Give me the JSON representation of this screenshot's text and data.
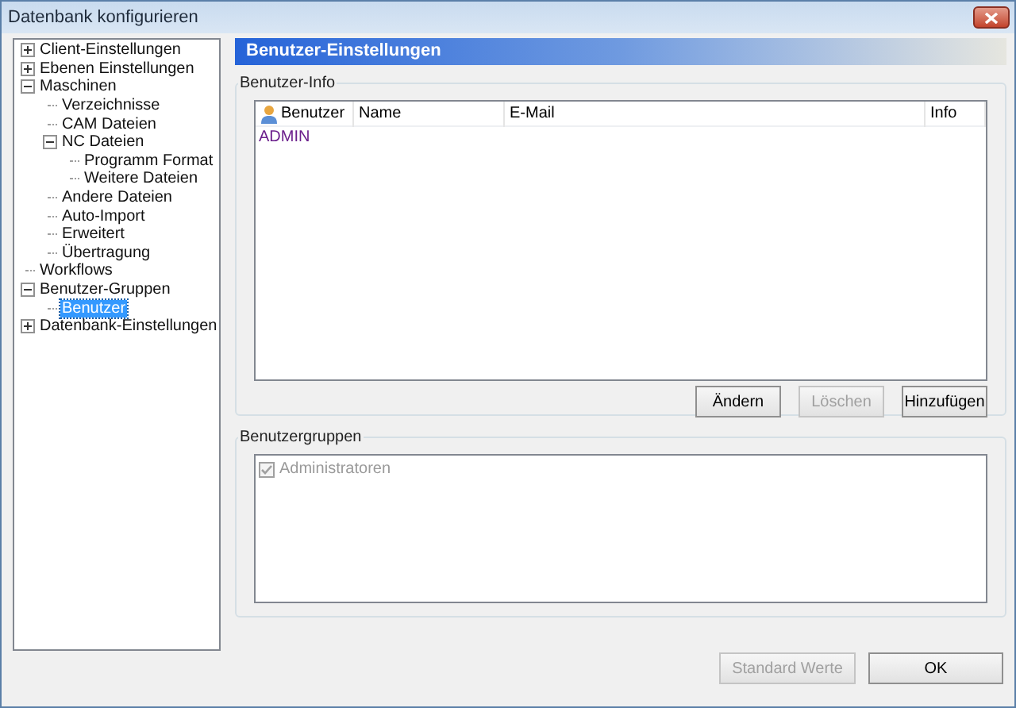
{
  "window": {
    "title": "Datenbank konfigurieren"
  },
  "tree": [
    {
      "label": "Client-Einstellungen",
      "expanded": false,
      "selected": false
    },
    {
      "label": "Ebenen Einstellungen",
      "expanded": false,
      "selected": false
    },
    {
      "label": "Maschinen",
      "expanded": true,
      "selected": false,
      "children": [
        {
          "label": "Verzeichnisse",
          "selected": false
        },
        {
          "label": "CAM Dateien",
          "selected": false
        },
        {
          "label": "NC Dateien",
          "expanded": true,
          "selected": false,
          "children": [
            {
              "label": "Programm Format",
              "selected": false
            },
            {
              "label": "Weitere Dateien",
              "selected": false
            }
          ]
        },
        {
          "label": "Andere Dateien",
          "selected": false
        },
        {
          "label": "Auto-Import",
          "selected": false
        },
        {
          "label": "Erweitert",
          "selected": false
        },
        {
          "label": "Übertragung",
          "selected": false
        }
      ]
    },
    {
      "label": "Workflows",
      "selected": false
    },
    {
      "label": "Benutzer-Gruppen",
      "expanded": true,
      "selected": false,
      "children": [
        {
          "label": "Benutzer",
          "selected": true
        }
      ]
    },
    {
      "label": "Datenbank-Einstellungen",
      "expanded": false,
      "selected": false
    }
  ],
  "header": {
    "title": "Benutzer-Einstellungen"
  },
  "user_info": {
    "title": "Benutzer-Info",
    "columns": [
      "Benutzer",
      "Name",
      "E-Mail",
      "Info"
    ],
    "rows": [
      {
        "benutzer": "ADMIN"
      }
    ],
    "buttons": [
      {
        "label": "Ändern",
        "disabled": false
      },
      {
        "label": "Löschen",
        "disabled": true
      },
      {
        "label": "Hinzufügen",
        "disabled": false
      }
    ]
  },
  "user_groups": {
    "title": "Benutzergruppen",
    "items": [
      {
        "label": "Administratoren",
        "checked": true,
        "disabled": true
      }
    ]
  },
  "footer_buttons": [
    {
      "label": "Standard Werte",
      "disabled": true
    },
    {
      "label": "OK",
      "disabled": false
    }
  ]
}
